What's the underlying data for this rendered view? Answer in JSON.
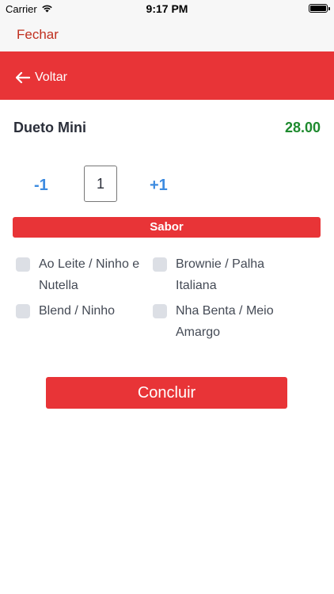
{
  "status_bar": {
    "carrier": "Carrier",
    "time": "9:17 PM"
  },
  "top_bar": {
    "close_label": "Fechar"
  },
  "header": {
    "back_label": "Voltar",
    "color": "#e83437"
  },
  "product": {
    "name": "Dueto Mini",
    "price": "28.00"
  },
  "quantity": {
    "decrement_label": "-1",
    "value": "1",
    "increment_label": "+1"
  },
  "flavor_section": {
    "title": "Sabor",
    "options": [
      {
        "label": "Ao Leite / Ninho e Nutella",
        "checked": false
      },
      {
        "label": "Brownie / Palha Italiana",
        "checked": false
      },
      {
        "label": "Blend / Ninho",
        "checked": false
      },
      {
        "label": "Nha Benta / Meio Amargo",
        "checked": false
      }
    ]
  },
  "submit": {
    "label": "Concluir"
  },
  "colors": {
    "accent": "#e83437",
    "price": "#1e8a2e",
    "link": "#3d8be0",
    "close": "#c0301f"
  }
}
